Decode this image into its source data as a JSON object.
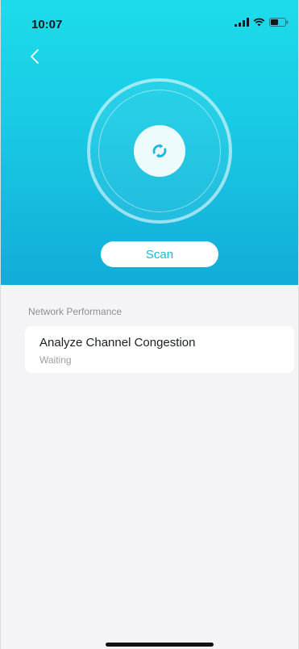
{
  "status_bar": {
    "time": "10:07",
    "icons": [
      "signal-icon",
      "wifi-icon",
      "battery-icon"
    ]
  },
  "navigation": {
    "back_icon": "chevron-left-icon"
  },
  "scan_panel": {
    "center_icon": "refresh-icon",
    "scan_label": "Scan"
  },
  "section": {
    "title": "Network Performance"
  },
  "items": [
    {
      "title": "Analyze Channel Congestion",
      "status": "Waiting"
    }
  ],
  "colors": {
    "hero_top": "#1cdcea",
    "hero_bottom": "#12acd8",
    "accent": "#19b8db",
    "page_background": "#f4f4f6",
    "card_background": "#ffffff",
    "secondary_text": "#9aa0a6"
  }
}
